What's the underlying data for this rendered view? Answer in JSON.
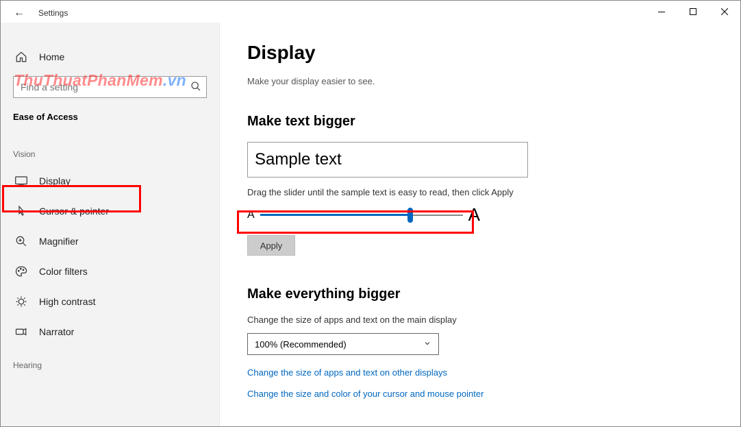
{
  "titlebar": {
    "back_aria": "Back",
    "title": "Settings"
  },
  "sidebar": {
    "home_label": "Home",
    "search_placeholder": "Find a setting",
    "category_title": "Ease of Access",
    "group_vision": "Vision",
    "group_hearing": "Hearing",
    "items": {
      "display": "Display",
      "cursor": "Cursor & pointer",
      "magnifier": "Magnifier",
      "color_filters": "Color filters",
      "high_contrast": "High contrast",
      "narrator": "Narrator"
    }
  },
  "main": {
    "page_title": "Display",
    "subtitle": "Make your display easier to see.",
    "text_section": {
      "heading": "Make text bigger",
      "sample": "Sample text",
      "hint": "Drag the slider until the sample text is easy to read, then click Apply",
      "small_a": "A",
      "big_a": "A",
      "apply": "Apply"
    },
    "everything_section": {
      "heading": "Make everything bigger",
      "desc": "Change the size of apps and text on the main display",
      "dropdown_value": "100% (Recommended)",
      "link1": "Change the size of apps and text on other displays",
      "link2": "Change the size and color of your cursor and mouse pointer"
    }
  },
  "watermark": {
    "a": "ThuThuatPhanMem",
    "b": ".vn"
  }
}
